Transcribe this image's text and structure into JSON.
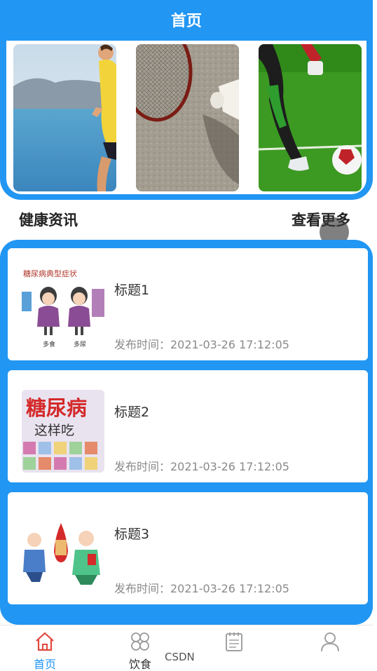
{
  "header": {
    "title": "首页"
  },
  "section": {
    "title": "健康资讯",
    "more": "查看更多"
  },
  "news": [
    {
      "title": "标题1",
      "time": "发布时间：2021-03-26 17:12:05",
      "thumb_text": "糖尿病典型症状",
      "thumb_captions": [
        "多食",
        "多尿"
      ]
    },
    {
      "title": "标题2",
      "time": "发布时间：2021-03-26 17:12:05",
      "thumb_text": [
        "糖尿病",
        "这样吃"
      ]
    },
    {
      "title": "标题3",
      "time": "发布时间：2021-03-26 17:12:05"
    }
  ],
  "tabs": [
    {
      "label": "首页",
      "icon": "home-icon",
      "active": true
    },
    {
      "label": "饮食",
      "icon": "grid-icon"
    },
    {
      "label": "",
      "icon": "notepad-icon"
    },
    {
      "label": "",
      "icon": "user-icon"
    }
  ],
  "watermark": "CSDN",
  "colors": {
    "accent": "#2196f3"
  }
}
